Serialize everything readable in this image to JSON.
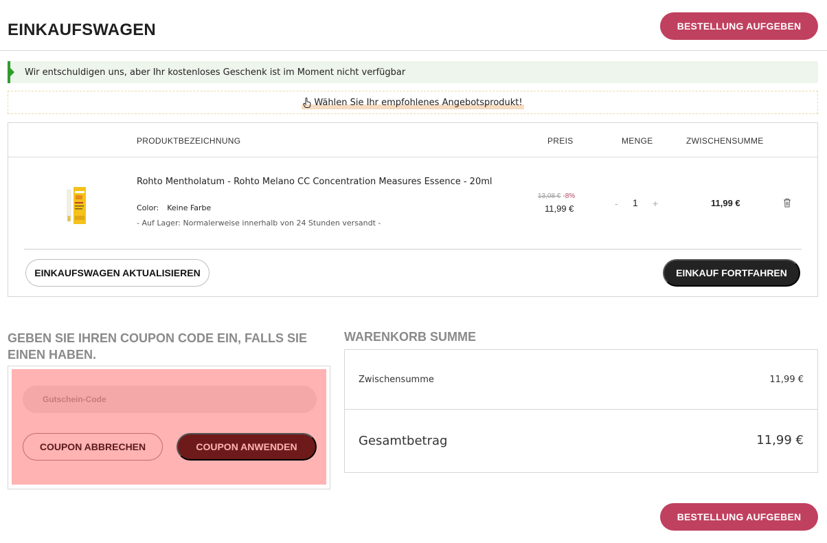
{
  "header": {
    "title": "EINKAUFSWAGEN",
    "order_button": "BESTELLUNG AUFGEBEN"
  },
  "notice": {
    "text": "Wir entschuldigen uns, aber Ihr kostenloses Geschenk ist im Moment nicht verfügbar",
    "accent_color": "#2e9c2e"
  },
  "offer": {
    "icon": "pointer-hand-icon",
    "text": "Wählen Sie Ihr empfohlenes Angebotsprodukt!"
  },
  "cart": {
    "columns": {
      "product": "PRODUKTBEZEICHNUNG",
      "price": "PREIS",
      "quantity": "MENGE",
      "subtotal": "ZWISCHENSUMME"
    },
    "items": [
      {
        "name": "Rohto Mentholatum - Rohto Melano CC Concentration Measures Essence - 20ml",
        "color_label": "Color:",
        "color_value": "Keine Farbe",
        "stock": "- Auf Lager: Normalerweise innerhalb von 24 Stunden versandt -",
        "old_price": "13,08 €",
        "discount": "-8%",
        "price": "11,99 €",
        "quantity": "1",
        "minus": "-",
        "plus": "+",
        "subtotal": "11,99 €"
      }
    ],
    "update_button": "EINKAUFSWAGEN AKTUALISIEREN",
    "continue_button": "EINKAUF FORTFAHREN"
  },
  "coupon": {
    "title": "GEBEN SIE IHREN COUPON CODE EIN, FALLS SIE EINEN HABEN.",
    "placeholder": "Gutschein-Code",
    "cancel_button": "COUPON ABBRECHEN",
    "apply_button": "COUPON ANWENDEN"
  },
  "summary": {
    "title": "WARENKORB SUMME",
    "subtotal_label": "Zwischensumme",
    "subtotal_value": "11,99 €",
    "total_label": "Gesamtbetrag",
    "total_value": "11,99 €"
  },
  "colors": {
    "brand": "#c0405f",
    "dark": "#232323",
    "coupon_bg": "#ffb3b3"
  }
}
